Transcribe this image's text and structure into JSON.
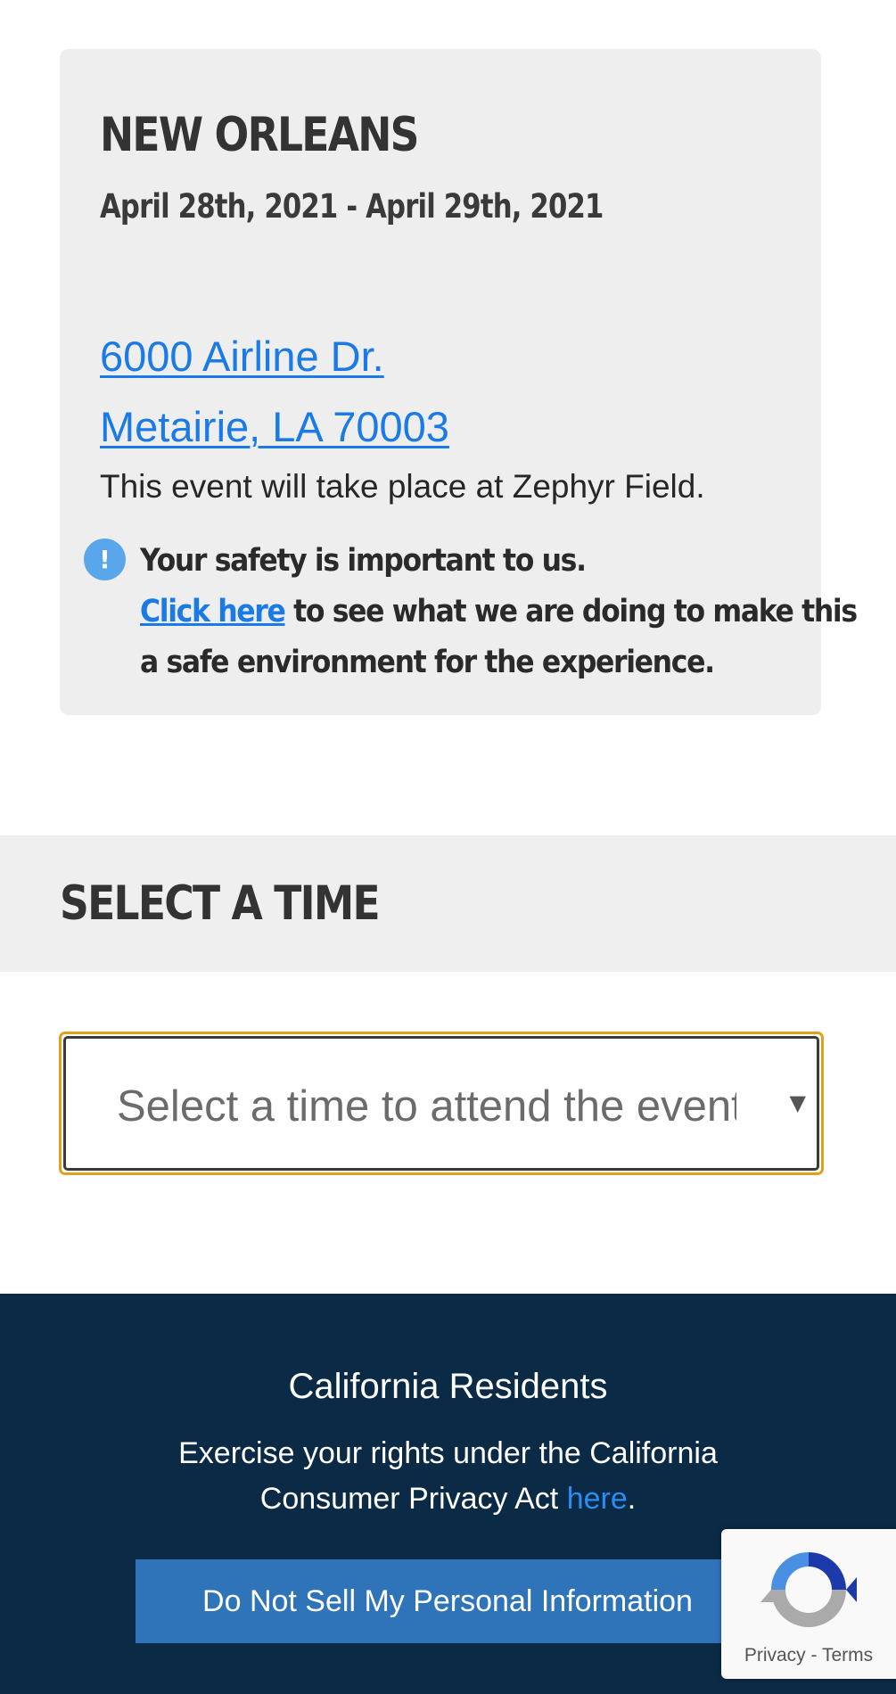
{
  "event": {
    "city": "NEW ORLEANS",
    "dates": "April 28th, 2021 - April 29th, 2021",
    "address_line1": "6000 Airline Dr.",
    "address_line2": "Metairie, LA 70003",
    "venue_note": "This event will take place at Zephyr Field.",
    "safety_heading": "Your safety is important to us.",
    "safety_link": "Click here",
    "safety_rest_line1": "to see what we are doing to make this",
    "safety_rest_line2": "a safe environment for the experience.",
    "info_icon_glyph": "!"
  },
  "time_section": {
    "title": "SELECT A TIME",
    "select_value": "Select a time to attend the event"
  },
  "footer": {
    "title": "California Residents",
    "text_line1": "Exercise your rights under the California",
    "text_line2_prefix": "Consumer Privacy Act",
    "link": "here",
    "period": ".",
    "button_label": "Do Not Sell My Personal Information"
  },
  "recaptcha": {
    "privacy": "Privacy",
    "separator": "-",
    "terms": "Terms"
  },
  "colors": {
    "link": "#1a7ae6",
    "footer_bg": "#0b2a45",
    "button_bg": "#2f74b8",
    "select_focus": "#e0a01a"
  }
}
